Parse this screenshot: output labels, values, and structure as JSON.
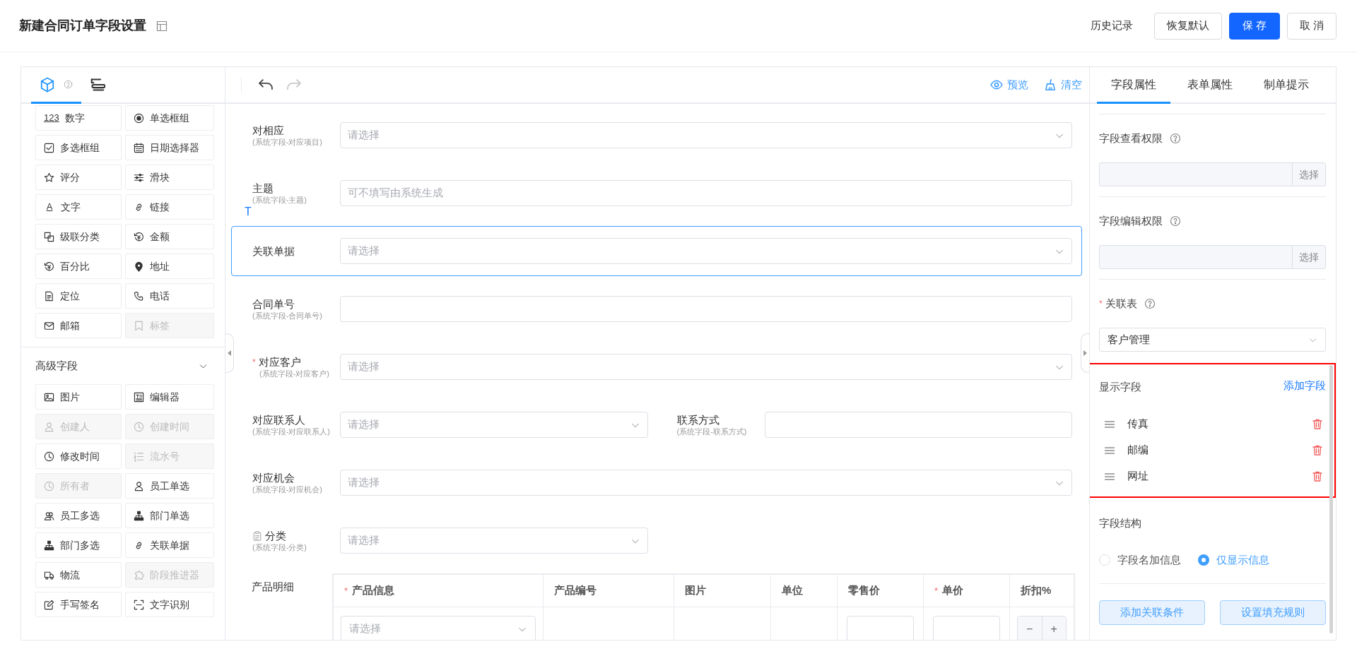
{
  "header": {
    "title": "新建合同订单字段设置",
    "actions": [
      {
        "label": "历史记录",
        "kind": "link"
      },
      {
        "label": "恢复默认",
        "kind": "outline"
      },
      {
        "label": "保 存",
        "kind": "primary"
      },
      {
        "label": "取 消",
        "kind": "outline"
      }
    ]
  },
  "palette": {
    "tabs": [
      {
        "kind": "components",
        "selected": true
      },
      {
        "kind": "outline",
        "selected": false
      }
    ],
    "basic_fields": [
      {
        "label": "数字",
        "kind": "text",
        "icon_text": "123",
        "disabled": false
      },
      {
        "label": "单选框组",
        "kind": "radio",
        "disabled": false
      },
      {
        "label": "多选框组",
        "kind": "checkbox",
        "disabled": false
      },
      {
        "label": "日期选择器",
        "kind": "calendar",
        "disabled": false
      },
      {
        "label": "评分",
        "kind": "star",
        "disabled": false
      },
      {
        "label": "滑块",
        "kind": "sliders",
        "disabled": false
      },
      {
        "label": "文字",
        "kind": "text",
        "icon_text": "A",
        "disabled": false
      },
      {
        "label": "链接",
        "kind": "link",
        "disabled": false
      },
      {
        "label": "级联分类",
        "kind": "cascade",
        "disabled": false
      },
      {
        "label": "金额",
        "kind": "money",
        "disabled": false
      },
      {
        "label": "百分比",
        "kind": "money",
        "disabled": false
      },
      {
        "label": "地址",
        "kind": "pin",
        "disabled": false
      },
      {
        "label": "定位",
        "kind": "doc",
        "disabled": false
      },
      {
        "label": "电话",
        "kind": "phone",
        "disabled": false
      },
      {
        "label": "邮箱",
        "kind": "mail",
        "disabled": false
      },
      {
        "label": "标签",
        "kind": "tag",
        "disabled": true
      }
    ],
    "advanced": {
      "title": "高级字段",
      "expanded": true,
      "fields": [
        {
          "label": "图片",
          "kind": "image",
          "disabled": false
        },
        {
          "label": "编辑器",
          "kind": "editor",
          "disabled": false
        },
        {
          "label": "创建人",
          "kind": "user",
          "disabled": true
        },
        {
          "label": "创建时间",
          "kind": "clock",
          "disabled": true
        },
        {
          "label": "修改时间",
          "kind": "clock",
          "disabled": false
        },
        {
          "label": "流水号",
          "kind": "list",
          "disabled": true
        },
        {
          "label": "所有者",
          "kind": "clock",
          "disabled": true
        },
        {
          "label": "员工单选",
          "kind": "user",
          "disabled": false
        },
        {
          "label": "员工多选",
          "kind": "users",
          "disabled": false
        },
        {
          "label": "部门单选",
          "kind": "org",
          "disabled": false
        },
        {
          "label": "部门多选",
          "kind": "org",
          "disabled": false
        },
        {
          "label": "关联单据",
          "kind": "link",
          "disabled": false
        },
        {
          "label": "物流",
          "kind": "truck",
          "disabled": false
        },
        {
          "label": "阶段推进器",
          "kind": "puzzle",
          "disabled": true
        },
        {
          "label": "手写签名",
          "kind": "edit",
          "disabled": false
        },
        {
          "label": "文字识别",
          "kind": "scan",
          "disabled": false
        }
      ]
    }
  },
  "toolbar": {
    "history": [
      {
        "kind": "undo",
        "disabled": false
      },
      {
        "kind": "redo",
        "disabled": true
      }
    ],
    "actions": [
      {
        "label": "预览",
        "kind": "eye"
      },
      {
        "label": "清空",
        "kind": "broom"
      }
    ]
  },
  "form": {
    "rows": [
      {
        "selected": false,
        "split": false,
        "fields": [
          {
            "label": "对相应",
            "sublabel": "(系统字段-对应项目)",
            "label_icon": false,
            "kind": "select",
            "placeholder": "请选择"
          }
        ]
      },
      {
        "selected": false,
        "split": false,
        "marker": "T",
        "fields": [
          {
            "label": "主题",
            "sublabel": "(系统字段-主题)",
            "label_icon": false,
            "kind": "input",
            "placeholder": "可不填写由系统生成"
          }
        ]
      },
      {
        "selected": true,
        "split": false,
        "fields": [
          {
            "label": "关联单据",
            "label_icon": false,
            "kind": "select",
            "placeholder": "请选择"
          }
        ]
      },
      {
        "selected": false,
        "split": false,
        "fields": [
          {
            "label": "合同单号",
            "sublabel": "(系统字段-合同单号)",
            "label_icon": false,
            "kind": "input"
          }
        ]
      },
      {
        "selected": false,
        "split": false,
        "fields": [
          {
            "label": "对应客户",
            "sublabel": "(系统字段-对应客户)",
            "required_mark": "*",
            "label_icon": false,
            "kind": "select",
            "placeholder": "请选择"
          }
        ]
      },
      {
        "selected": false,
        "split": true,
        "fields": [
          {
            "label": "对应联系人",
            "sublabel": "(系统字段-对应联系人)",
            "label_icon": false,
            "kind": "select",
            "placeholder": "请选择"
          },
          {
            "label": "联系方式",
            "sublabel": "(系统字段-联系方式)",
            "label_icon": false,
            "kind": "input"
          }
        ]
      },
      {
        "selected": false,
        "split": false,
        "fields": [
          {
            "label": "对应机会",
            "sublabel": "(系统字段-对应机会)",
            "label_icon": false,
            "kind": "select",
            "placeholder": "请选择"
          }
        ]
      },
      {
        "selected": false,
        "split": true,
        "fields": [
          {
            "label": "分类",
            "sublabel": "(系统字段-分类)",
            "label_icon": true,
            "kind": "select",
            "placeholder": "请选择"
          }
        ]
      }
    ],
    "table": {
      "label": "产品明细",
      "columns": [
        {
          "label": "产品信息",
          "required_mark": "*"
        },
        {
          "label": "产品编号"
        },
        {
          "label": "图片"
        },
        {
          "label": "单位"
        },
        {
          "label": "零售价"
        },
        {
          "label": "单价",
          "required_mark": "*"
        },
        {
          "label": "折扣%"
        }
      ],
      "rows": [
        {
          "cells": [
            {
              "kind": "select",
              "placeholder": "请选择"
            },
            {
              "kind": "empty"
            },
            {
              "kind": "empty"
            },
            {
              "kind": "empty"
            },
            {
              "kind": "input"
            },
            {
              "kind": "input"
            },
            {
              "kind": "stepper",
              "minus": "−",
              "plus": "+"
            }
          ]
        }
      ]
    }
  },
  "properties": {
    "tabs": [
      {
        "label": "字段属性",
        "selected": true
      },
      {
        "label": "表单属性",
        "selected": false
      },
      {
        "label": "制单提示",
        "selected": false
      }
    ],
    "sections": [
      {
        "kind": "permission",
        "label": "字段查看权限",
        "button": "选择"
      },
      {
        "kind": "permission",
        "label": "字段编辑权限",
        "button": "选择"
      },
      {
        "kind": "select",
        "label": "关联表",
        "required_mark": "*",
        "value": "客户管理"
      }
    ],
    "display_fields": {
      "title": "显示字段",
      "add_label": "添加字段",
      "items": [
        {
          "label": "传真"
        },
        {
          "label": "邮编"
        },
        {
          "label": "网址"
        }
      ]
    },
    "structure": {
      "title": "字段结构",
      "options": [
        {
          "label": "字段名加信息",
          "selected": false
        },
        {
          "label": "仅显示信息",
          "selected": true
        }
      ]
    },
    "buttons": [
      "添加关联条件",
      "设置填充规则"
    ]
  }
}
